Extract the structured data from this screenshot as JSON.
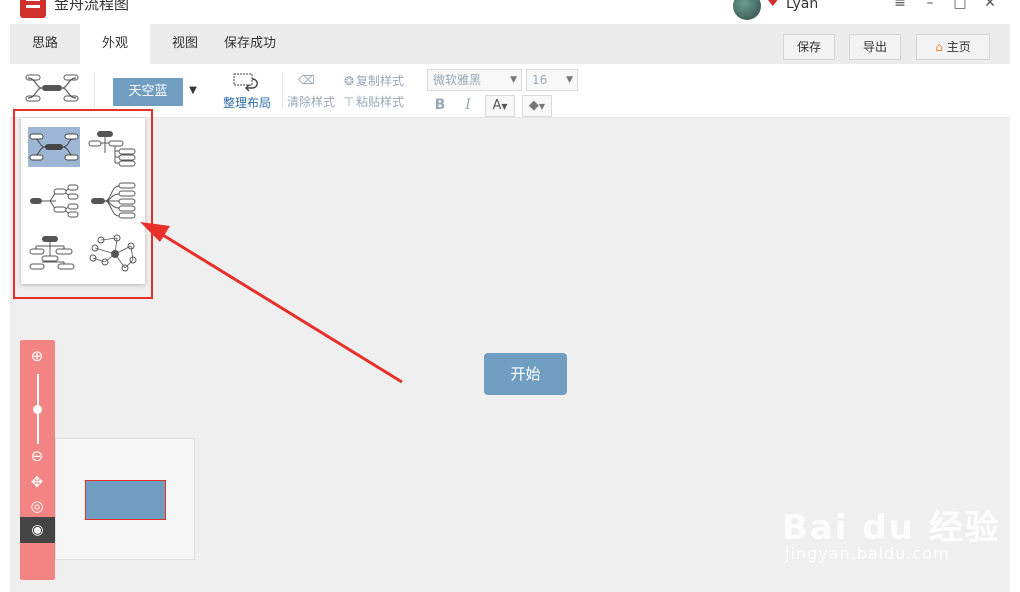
{
  "app": {
    "title": "金舟流程图"
  },
  "user": {
    "name": "Lyan"
  },
  "window_controls": {
    "menu": "≡",
    "minimize": "–",
    "maximize": "□",
    "close": "✕"
  },
  "menu": {
    "tabs": [
      {
        "label": "思路"
      },
      {
        "label": "外观"
      },
      {
        "label": "视图"
      }
    ],
    "active_tab": "外观",
    "save_status": "保存成功",
    "save_button": "保存",
    "export_button": "导出",
    "home_button": "主页"
  },
  "toolbar": {
    "theme_label": "天空蓝",
    "arrange_label": "整理布局",
    "clear_style": "清除样式",
    "copy_style": "复制样式",
    "paste_style": "粘贴样式",
    "font_family": "微软雅黑",
    "font_size": "16",
    "bold": "B",
    "italic": "I",
    "font_color": "A"
  },
  "canvas": {
    "start_node_label": "开始"
  },
  "watermark": {
    "main": "Bai du 经验",
    "sub": "jingyan.baidu.com"
  },
  "colors": {
    "accent": "#6f9ec1",
    "highlight": "#e8302b",
    "zoom_bar": "#f38484",
    "canvas_bg": "#efefef"
  }
}
